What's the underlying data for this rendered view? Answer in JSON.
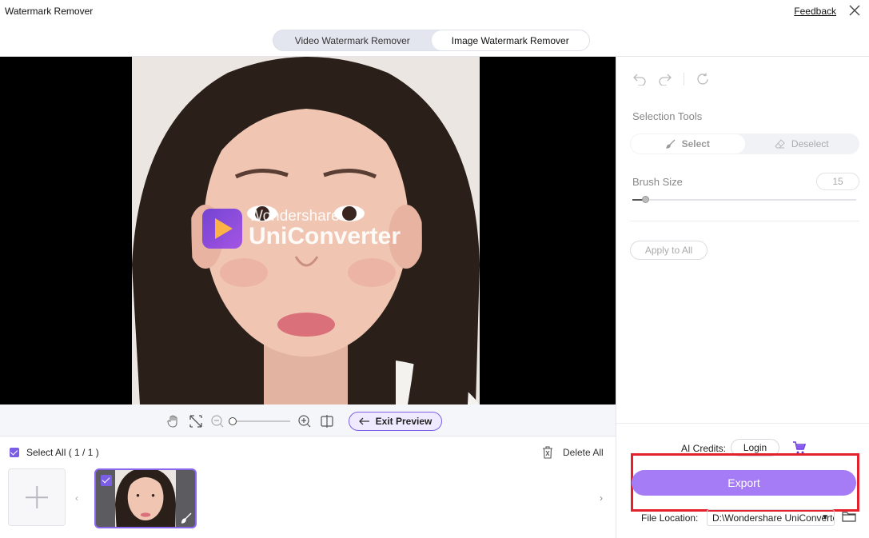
{
  "window": {
    "title": "Watermark Remover",
    "feedback_label": "Feedback"
  },
  "mode_tabs": [
    {
      "label": "Video Watermark Remover",
      "active": false
    },
    {
      "label": "Image Watermark Remover",
      "active": true
    }
  ],
  "canvas": {
    "watermark_line1": "Wondershare",
    "watermark_line2": "UniConverter"
  },
  "zoom_bar": {
    "icons": [
      "hand-icon",
      "fit-screen-icon",
      "zoom-out-icon",
      "zoom-in-icon",
      "compare-icon"
    ],
    "exit_preview_label": "Exit Preview"
  },
  "file_strip": {
    "select_all_label": "Select All ( 1 / 1 )",
    "delete_all_label": "Delete All",
    "left_arrow": "‹",
    "right_arrow": "›"
  },
  "panel": {
    "selection_tools_label": "Selection Tools",
    "select_label": "Select",
    "deselect_label": "Deselect",
    "brush_size_label": "Brush Size",
    "brush_size_value": "15",
    "apply_all_label": "Apply to All",
    "ai_credits_label": "AI Credits:",
    "login_label": "Login",
    "export_label": "Export",
    "file_location_label": "File Location:",
    "file_location_value": "D:\\Wondershare UniConverter",
    "chevron": "▼"
  },
  "colors": {
    "accent": "#7b5ee6",
    "export": "#a57cf5",
    "highlight": "#e3202b"
  }
}
